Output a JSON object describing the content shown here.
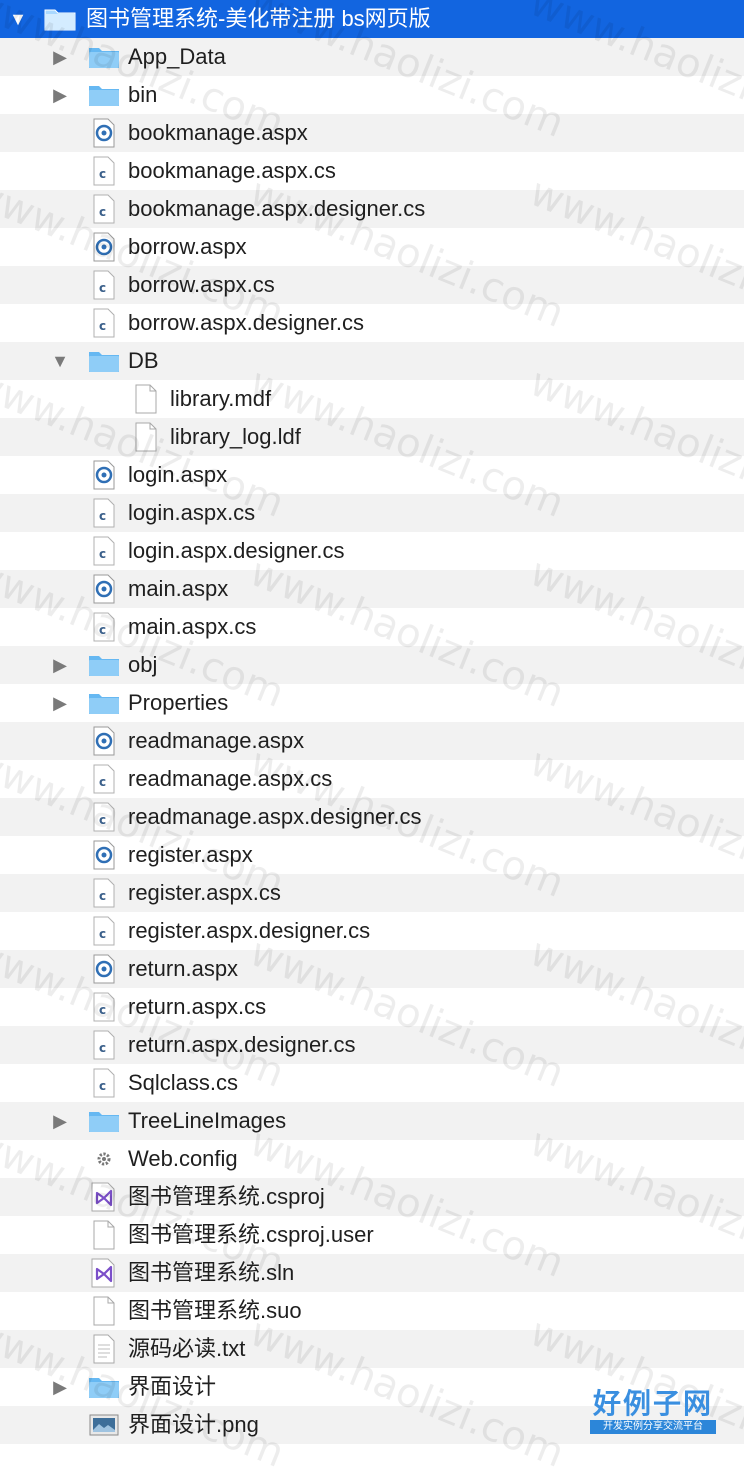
{
  "root": {
    "label": "图书管理系统-美化带注册 bs网页版",
    "expanded": true,
    "selected": true
  },
  "items": [
    {
      "label": "App_Data",
      "type": "folder",
      "level": 1,
      "disclosure": "collapsed"
    },
    {
      "label": "bin",
      "type": "folder",
      "level": 1,
      "disclosure": "collapsed"
    },
    {
      "label": "bookmanage.aspx",
      "type": "aspx",
      "level": 1
    },
    {
      "label": "bookmanage.aspx.cs",
      "type": "cs",
      "level": 1
    },
    {
      "label": "bookmanage.aspx.designer.cs",
      "type": "cs",
      "level": 1
    },
    {
      "label": "borrow.aspx",
      "type": "aspx",
      "level": 1
    },
    {
      "label": "borrow.aspx.cs",
      "type": "cs",
      "level": 1
    },
    {
      "label": "borrow.aspx.designer.cs",
      "type": "cs",
      "level": 1
    },
    {
      "label": "DB",
      "type": "folder",
      "level": 1,
      "disclosure": "expanded"
    },
    {
      "label": "library.mdf",
      "type": "doc",
      "level": 2
    },
    {
      "label": "library_log.ldf",
      "type": "doc",
      "level": 2
    },
    {
      "label": "login.aspx",
      "type": "aspx",
      "level": 1
    },
    {
      "label": "login.aspx.cs",
      "type": "cs",
      "level": 1
    },
    {
      "label": "login.aspx.designer.cs",
      "type": "cs",
      "level": 1
    },
    {
      "label": "main.aspx",
      "type": "aspx",
      "level": 1
    },
    {
      "label": "main.aspx.cs",
      "type": "cs",
      "level": 1
    },
    {
      "label": "obj",
      "type": "folder",
      "level": 1,
      "disclosure": "collapsed"
    },
    {
      "label": "Properties",
      "type": "folder",
      "level": 1,
      "disclosure": "collapsed"
    },
    {
      "label": "readmanage.aspx",
      "type": "aspx",
      "level": 1
    },
    {
      "label": "readmanage.aspx.cs",
      "type": "cs",
      "level": 1
    },
    {
      "label": "readmanage.aspx.designer.cs",
      "type": "cs",
      "level": 1
    },
    {
      "label": "register.aspx",
      "type": "aspx",
      "level": 1
    },
    {
      "label": "register.aspx.cs",
      "type": "cs",
      "level": 1
    },
    {
      "label": "register.aspx.designer.cs",
      "type": "cs",
      "level": 1
    },
    {
      "label": "return.aspx",
      "type": "aspx",
      "level": 1
    },
    {
      "label": "return.aspx.cs",
      "type": "cs",
      "level": 1
    },
    {
      "label": "return.aspx.designer.cs",
      "type": "cs",
      "level": 1
    },
    {
      "label": "Sqlclass.cs",
      "type": "cs",
      "level": 1
    },
    {
      "label": "TreeLineImages",
      "type": "folder",
      "level": 1,
      "disclosure": "collapsed"
    },
    {
      "label": "Web.config",
      "type": "config",
      "level": 1
    },
    {
      "label": "图书管理系统.csproj",
      "type": "vs",
      "level": 1
    },
    {
      "label": "图书管理系统.csproj.user",
      "type": "doc",
      "level": 1
    },
    {
      "label": "图书管理系统.sln",
      "type": "vs",
      "level": 1
    },
    {
      "label": "图书管理系统.suo",
      "type": "doc",
      "level": 1
    },
    {
      "label": "源码必读.txt",
      "type": "txt",
      "level": 1
    },
    {
      "label": "界面设计",
      "type": "folder",
      "level": 1,
      "disclosure": "collapsed"
    },
    {
      "label": "界面设计.png",
      "type": "image",
      "level": 1
    }
  ],
  "watermark": {
    "text": "www.haolizi.com"
  },
  "logo": {
    "title": "好例子网",
    "subtitle": "开发实例分享交流平台"
  },
  "colors": {
    "selection": "#1265e0",
    "folder": "#66b8f2",
    "aspx": "#2f6fb5",
    "vs": "#7b4fc9"
  },
  "icons": {
    "folder": "folder-icon",
    "aspx": "aspx-file-icon",
    "cs": "csharp-file-icon",
    "doc": "document-icon",
    "config": "config-gear-icon",
    "vs": "visual-studio-icon",
    "txt": "text-file-icon",
    "image": "image-file-icon"
  }
}
